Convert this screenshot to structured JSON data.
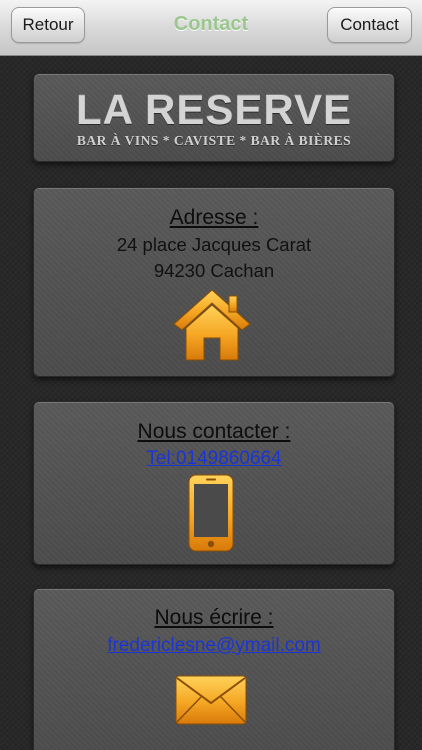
{
  "navbar": {
    "back_label": "Retour",
    "title": "Contact",
    "right_label": "Contact"
  },
  "logo": {
    "title": "LA RESERVE",
    "subtitle": "BAR À VINS * CAVISTE * BAR À BIÈRES"
  },
  "address": {
    "heading": "Adresse :",
    "line1": "24 place Jacques Carat",
    "line2": "94230 Cachan",
    "icon": "home-icon"
  },
  "phone": {
    "heading": "Nous contacter :",
    "link": "Tel:0149860664",
    "icon": "phone-icon"
  },
  "email": {
    "heading": "Nous écrire :",
    "link": "fredericlesne@ymail.com",
    "icon": "mail-icon"
  },
  "colors": {
    "background": "#262626",
    "card": "#545454",
    "title_green": "#9bc78f",
    "link_blue": "#1a34d6",
    "icon_orange": "#f5a623"
  }
}
